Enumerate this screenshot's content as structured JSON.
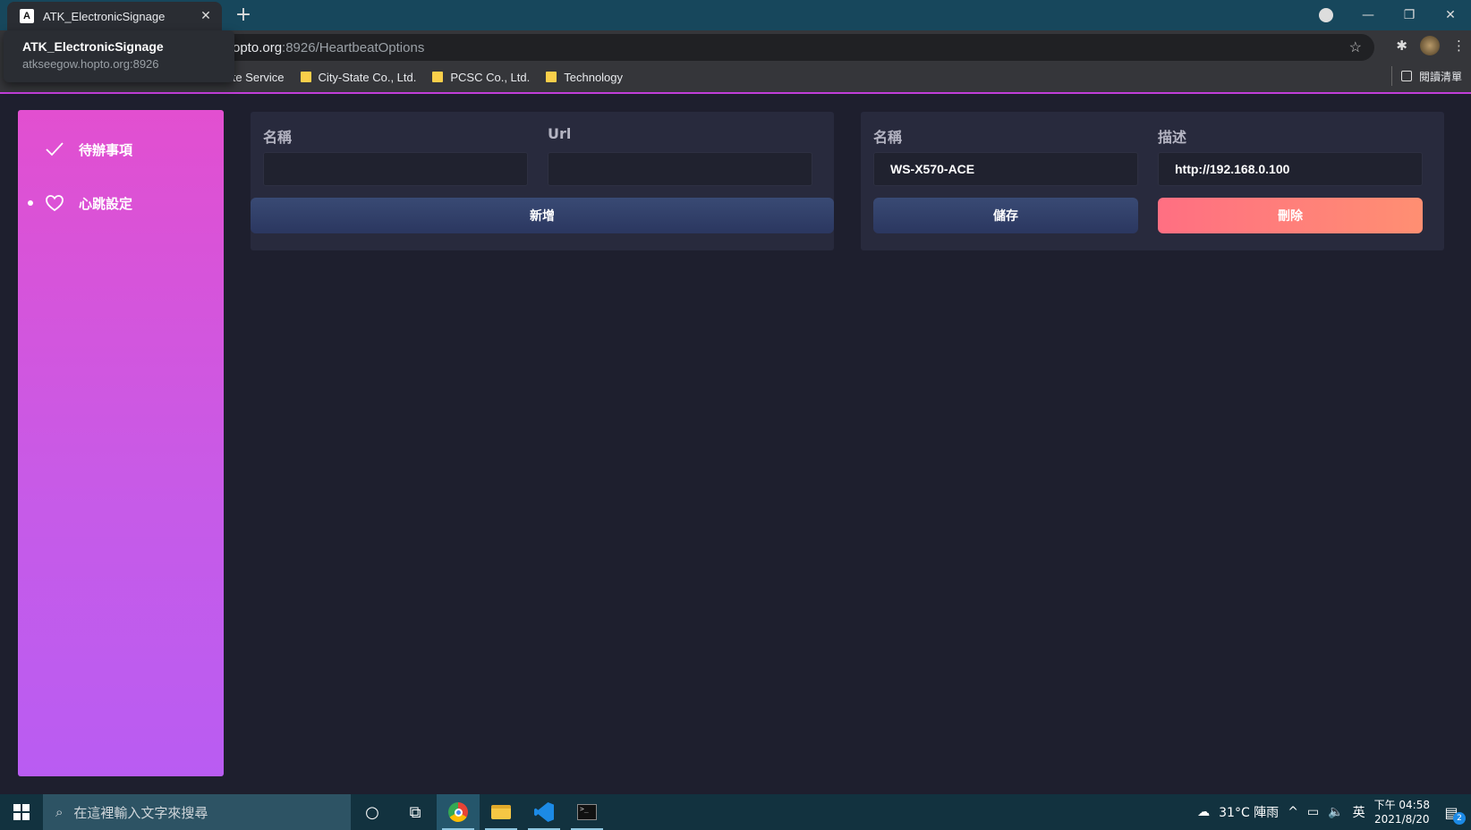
{
  "browser": {
    "tab_title": "ATK_ElectronicSignage",
    "tab_favicon": "A",
    "new_tab": "+",
    "url_host": "opto.org",
    "url_path": ":8926/HeartbeatOptions",
    "tooltip": {
      "title": "ATK_ElectronicSignage",
      "url": "atkseegow.hopto.org:8926"
    },
    "bookmarks": [
      {
        "label": "vate Service"
      },
      {
        "label": "City-State Co., Ltd."
      },
      {
        "label": "PCSC Co., Ltd."
      },
      {
        "label": "Technology"
      }
    ],
    "reading_list": "閱讀清單"
  },
  "sidebar": {
    "items": [
      {
        "label": "待辦事項",
        "icon": "check-icon"
      },
      {
        "label": "心跳設定",
        "icon": "heart-icon",
        "active": true
      }
    ]
  },
  "new_form": {
    "name_label": "名稱",
    "url_label": "Url",
    "name_value": "",
    "url_value": "",
    "add_button": "新增"
  },
  "edit_form": {
    "name_label": "名稱",
    "desc_label": "描述",
    "name_value": "WS-X570-ACE",
    "desc_value": "http://192.168.0.100",
    "save_button": "儲存",
    "delete_button": "刪除"
  },
  "taskbar": {
    "search_placeholder": "在這裡輸入文字來搜尋",
    "weather": "31°C  陣雨",
    "ime": "英",
    "time": "下午 04:58",
    "date": "2021/8/20",
    "notification_count": "2"
  },
  "colors": {
    "accent": "#c13ed9",
    "sidebar_top": "#e24fd0",
    "sidebar_bottom": "#b95cf2",
    "delete": "#ff6f82",
    "card": "#282a3d"
  }
}
